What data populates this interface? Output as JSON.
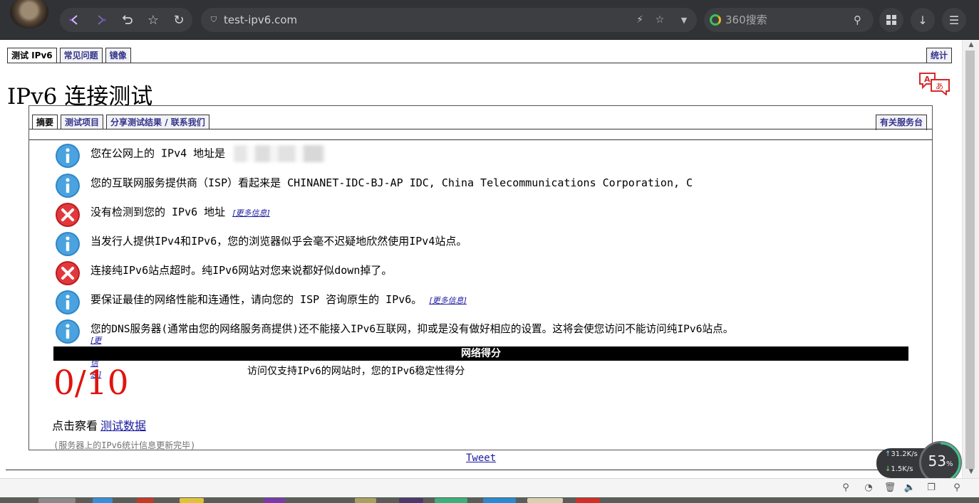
{
  "browser": {
    "url": "test-ipv6.com",
    "search_placeholder": "360搜索"
  },
  "page": {
    "top_tabs": [
      "测试 IPv6",
      "常见问题",
      "镜像"
    ],
    "stats_tab": "统计",
    "title": "IPv6 连接测试",
    "inner_tabs": [
      "摘要",
      "测试项目",
      "分享测试结果 / 联系我们"
    ],
    "help_tab": "有关服务台",
    "messages": [
      {
        "icon": "info",
        "text": "您在公网上的 IPv4 地址是",
        "more": ""
      },
      {
        "icon": "info",
        "text": "您的互联网服务提供商（ISP）看起来是 CHINANET-IDC-BJ-AP IDC, China Telecommunications Corporation, C",
        "more": ""
      },
      {
        "icon": "error",
        "text": "没有检测到您的 IPv6 地址",
        "more": "[更多信息]"
      },
      {
        "icon": "info",
        "text": "当发行人提供IPv4和IPv6，您的浏览器似乎会毫不迟疑地欣然使用IPv4站点。",
        "more": ""
      },
      {
        "icon": "error",
        "text": "连接纯IPv6站点超时。纯IPv6网站对您来说都好似down掉了。",
        "more": ""
      },
      {
        "icon": "info",
        "text": "要保证最佳的网络性能和连通性，请向您的 ISP 咨询原生的 IPv6。",
        "more": "[更多信息]"
      },
      {
        "icon": "info",
        "text": "您的DNS服务器(通常由您的网络服务商提供)还不能接入IPv6互联网，抑或是没有做好相应的设置。这将会使您访问不能访问纯IPv6站点。",
        "more": "[更多信息]"
      }
    ],
    "score_header": "网络得分",
    "score": "0/10",
    "score_desc": "访问仅支持IPv6的网站时，您的IPv6稳定性得分",
    "view_data_prefix": "点击察看",
    "view_data_link": "测试数据",
    "footnote": "(服务器上的IPv6统计信息更新完毕)",
    "tweet": "Tweet"
  },
  "speed_widget": {
    "up": "31.2K/s",
    "down": "1.5K/s",
    "percent": "53",
    "percent_unit": "%"
  },
  "colors": {
    "info": "#2e86c8",
    "error": "#d9252a",
    "score": "#e0140f",
    "link": "#1a1aa0"
  }
}
